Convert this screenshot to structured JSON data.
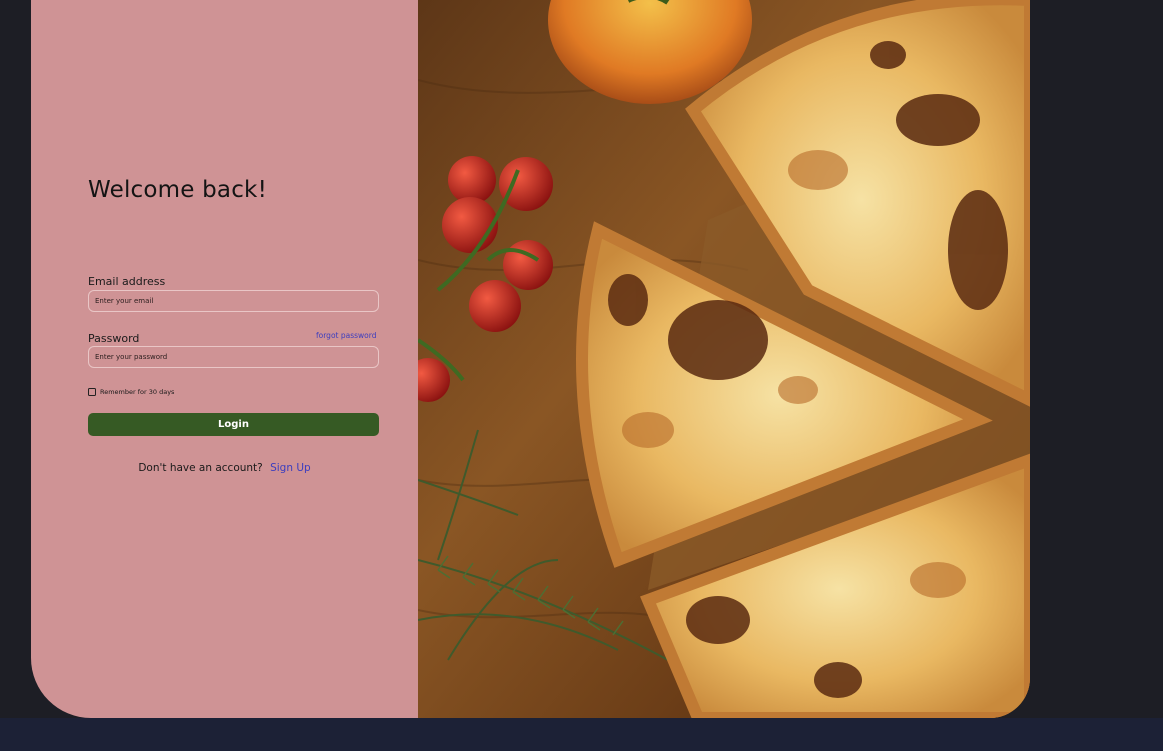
{
  "heading": "Welcome back!",
  "email": {
    "label": "Email address",
    "placeholder": "Enter your email"
  },
  "password": {
    "label": "Password",
    "placeholder": "Enter your password",
    "forgot_link": "forgot password"
  },
  "remember": {
    "label": "Remember for 30 days"
  },
  "login_button": "Login",
  "signup": {
    "prompt": "Don't have an account?",
    "link": "Sign Up"
  },
  "colors": {
    "panel": "#cf9395",
    "button": "#365a24",
    "link": "#3b3dbf",
    "background": "#1d1e25"
  },
  "hero_image": {
    "icon": "pizza-photo"
  }
}
